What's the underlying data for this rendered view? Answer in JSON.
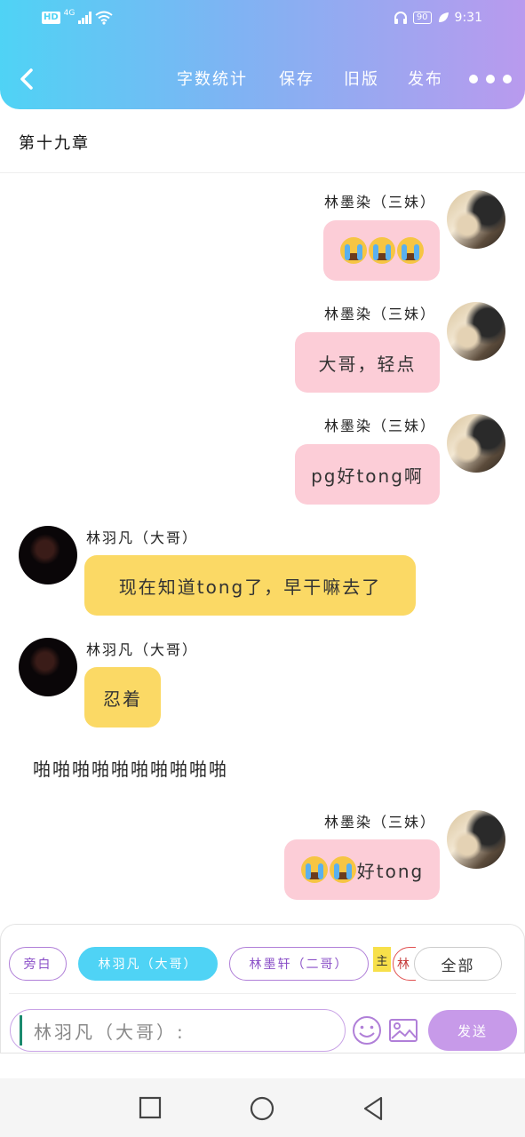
{
  "status": {
    "hd": "HD",
    "network": "4G",
    "battery": "90",
    "time": "9:31"
  },
  "toolbar": {
    "word_count": "字数统计",
    "save": "保存",
    "old_version": "旧版",
    "publish": "发布"
  },
  "chapter_title": "第十九章",
  "messages": [
    {
      "sender": "林墨染（三妹）",
      "text": "",
      "side": "right",
      "color": "#fccdd7",
      "emoji": "crying-face x3"
    },
    {
      "sender": "林墨染（三妹）",
      "text": "大哥，轻点",
      "side": "right",
      "color": "#fccdd7"
    },
    {
      "sender": "林墨染（三妹）",
      "text": "pg好tong啊",
      "side": "right",
      "color": "#fccdd7"
    },
    {
      "sender": "林羽凡（大哥）",
      "text": "现在知道tong了，早干嘛去了",
      "side": "left",
      "color": "#fbd965"
    },
    {
      "sender": "林羽凡（大哥）",
      "text": "忍着",
      "side": "left",
      "color": "#fbd965"
    },
    {
      "sender": "林墨染（三妹）",
      "text": "好tong",
      "side": "right",
      "color": "#fccdd7",
      "emoji": "crying-face x2"
    }
  ],
  "narration": "啪啪啪啪啪啪啪啪啪啪",
  "characters": {
    "narration": "旁白",
    "brother1": "林羽凡（大哥）",
    "brother2": "林墨轩（二哥）",
    "main_tag": "主",
    "main_partial": "林",
    "all": "全部"
  },
  "input": {
    "value": "林羽凡（大哥）:"
  },
  "send_label": "发送",
  "colors": {
    "accent_cyan": "#4fd3f5",
    "accent_purple": "#c79ae9",
    "bubble_pink": "#fccdd7",
    "bubble_yellow": "#fbd965"
  }
}
